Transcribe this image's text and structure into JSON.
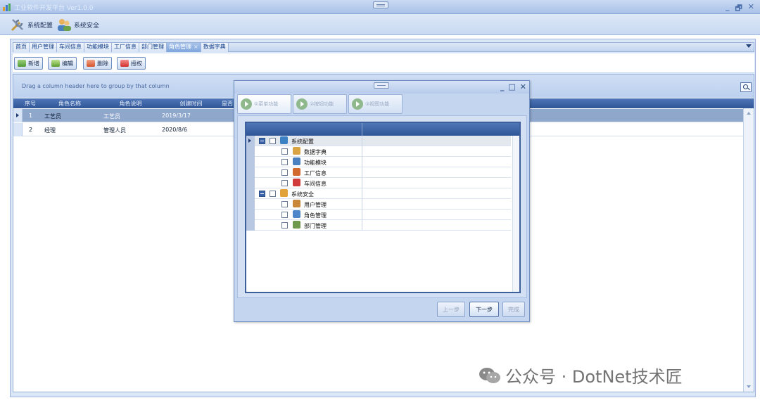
{
  "window": {
    "title": "工业软件开发平台 Ver1.0.0",
    "controls": [
      "_",
      "🗗",
      "✕"
    ]
  },
  "ribbon": [
    {
      "label": "系统配置",
      "icon": "tools-icon"
    },
    {
      "label": "系统安全",
      "icon": "users-icon"
    }
  ],
  "tabs": [
    {
      "label": "首页",
      "active": false
    },
    {
      "label": "用户管理",
      "active": false
    },
    {
      "label": "车间信息",
      "active": false
    },
    {
      "label": "功能模块",
      "active": false
    },
    {
      "label": "工厂信息",
      "active": false
    },
    {
      "label": "部门管理",
      "active": false
    },
    {
      "label": "角色管理",
      "active": true,
      "close": "×"
    },
    {
      "label": "数据字典",
      "active": false
    }
  ],
  "toolbar": {
    "add_label": "新增",
    "edit_label": "编辑",
    "delete_label": "删除",
    "auth_label": "授权"
  },
  "grid": {
    "group_hint": "Drag a column header here to group by that column",
    "columns": [
      "序号",
      "角色名称",
      "角色说明",
      "创建时间",
      "是否"
    ],
    "rows": [
      {
        "no": "1",
        "name": "工艺员",
        "desc": "工艺员",
        "date": "2019/3/17",
        "checked": true
      },
      {
        "no": "2",
        "name": "经理",
        "desc": "管理人员",
        "date": "2020/8/6",
        "checked": true
      }
    ]
  },
  "dialog": {
    "controls": [
      "_",
      "□",
      "✕"
    ],
    "steps": [
      {
        "label": "①菜单功能",
        "active": true
      },
      {
        "label": "②按钮功能",
        "active": false
      },
      {
        "label": "③视图功能",
        "active": false
      }
    ],
    "tree": [
      {
        "label": "系统配置",
        "level": 0,
        "icon": "tools-icon",
        "color": "#3b82c4"
      },
      {
        "label": "数据字典",
        "level": 1,
        "icon": "dictionary-icon",
        "color": "#d9a441"
      },
      {
        "label": "功能模块",
        "level": 1,
        "icon": "module-icon",
        "color": "#4a7fc0"
      },
      {
        "label": "工厂信息",
        "level": 1,
        "icon": "factory-icon",
        "color": "#d2692e"
      },
      {
        "label": "车间信息",
        "level": 1,
        "icon": "calendar-icon",
        "color": "#d23b3b"
      },
      {
        "label": "系统安全",
        "level": 0,
        "icon": "users-icon",
        "color": "#e2a23a"
      },
      {
        "label": "用户管理",
        "level": 1,
        "icon": "user-icon",
        "color": "#c9873a"
      },
      {
        "label": "角色管理",
        "level": 1,
        "icon": "role-icon",
        "color": "#4f86c9"
      },
      {
        "label": "部门管理",
        "level": 1,
        "icon": "department-icon",
        "color": "#6f9a4d"
      }
    ],
    "buttons": {
      "prev": "上一步",
      "next": "下一步",
      "finish": "完成"
    }
  },
  "watermark": "公众号 · DotNet技术匠"
}
